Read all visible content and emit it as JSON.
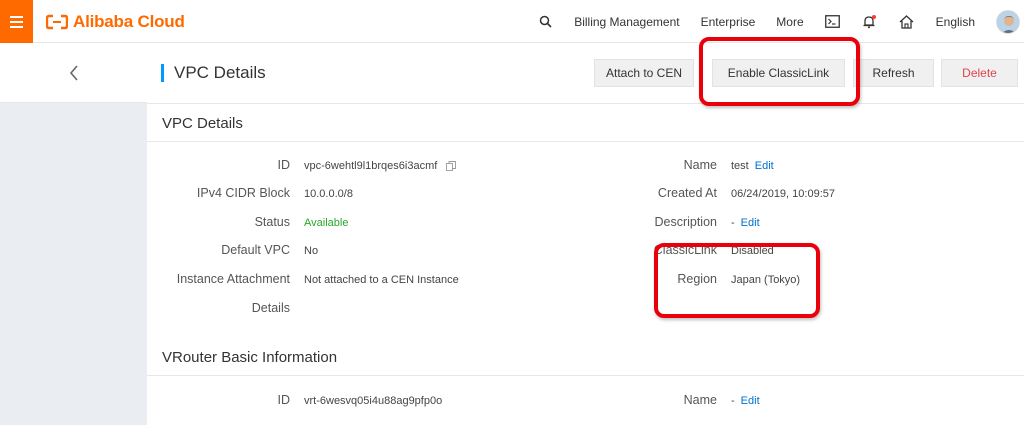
{
  "header": {
    "brand": "Alibaba Cloud",
    "nav": {
      "billing": "Billing Management",
      "enterprise": "Enterprise",
      "more": "More",
      "language": "English"
    },
    "icons": [
      "menu-icon",
      "search-icon",
      "terminal-icon",
      "bell-icon",
      "home-icon"
    ],
    "accent_color": "#ff6a00"
  },
  "page": {
    "title": "VPC Details",
    "buttons": {
      "attach": "Attach to CEN",
      "enable_classiclink": "Enable ClassicLink",
      "refresh": "Refresh",
      "delete": "Delete"
    }
  },
  "vpc": {
    "section_title": "VPC Details",
    "left": [
      {
        "label": "ID",
        "value": "vpc-6wehtl9l1brqes6i3acmf"
      },
      {
        "label": "IPv4 CIDR Block",
        "value": "10.0.0.0/8"
      },
      {
        "label": "Status",
        "value": "Available"
      },
      {
        "label": "Default VPC",
        "value": "No"
      },
      {
        "label": "Instance Attachment",
        "value": "Not attached to a CEN Instance"
      },
      {
        "label": "Details",
        "value": ""
      }
    ],
    "right": [
      {
        "label": "Name",
        "value": "test",
        "link": "Edit"
      },
      {
        "label": "Created At",
        "value": "06/24/2019, 10:09:57"
      },
      {
        "label": "Description",
        "value": "-",
        "link": "Edit"
      },
      {
        "label": "ClassicLink",
        "value": "Disabled"
      },
      {
        "label": "Region",
        "value": "Japan (Tokyo)"
      }
    ]
  },
  "vrouter": {
    "section_title": "VRouter Basic Information",
    "left": [
      {
        "label": "ID",
        "value": "vrt-6wesvq05i4u88ag9pfp0o"
      }
    ],
    "right": [
      {
        "label": "Name",
        "value": "-",
        "link": "Edit"
      }
    ]
  },
  "colors": {
    "status_ok": "#2aa72a",
    "link": "#0070cc",
    "danger": "#e0434b",
    "highlight": "#e8000b"
  }
}
